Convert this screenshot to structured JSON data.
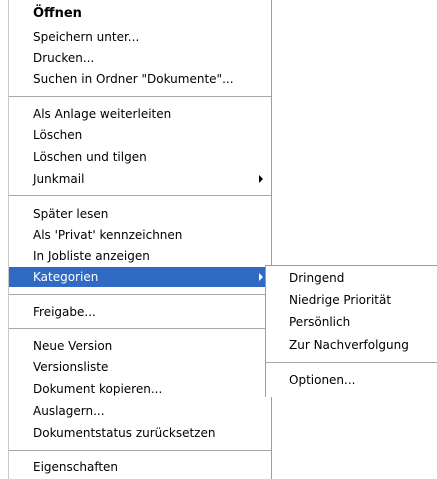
{
  "main_menu": {
    "open": "Öffnen",
    "save_as": "Speichern unter...",
    "print": "Drucken...",
    "search_in_folder": "Suchen in Ordner \"Dokumente\"...",
    "forward_as_attachment": "Als Anlage weiterleiten",
    "delete": "Löschen",
    "delete_and_purge": "Löschen und tilgen",
    "junk_mail": "Junkmail",
    "read_later": "Später lesen",
    "mark_private": "Als 'Privat' kennzeichnen",
    "show_in_joblist": "In Jobliste anzeigen",
    "categories": "Kategorien",
    "share": "Freigabe...",
    "new_version": "Neue Version",
    "version_list": "Versionsliste",
    "copy_document": "Dokument kopieren...",
    "archive": "Auslagern...",
    "reset_status": "Dokumentstatus zurücksetzen",
    "properties": "Eigenschaften"
  },
  "sub_menu": {
    "urgent": "Dringend",
    "low_priority": "Niedrige Priorität",
    "personal": "Persönlich",
    "follow_up": "Zur Nachverfolgung",
    "options": "Optionen..."
  },
  "colors": {
    "selection": "#316ac5",
    "separator": "#a7a6aa"
  }
}
